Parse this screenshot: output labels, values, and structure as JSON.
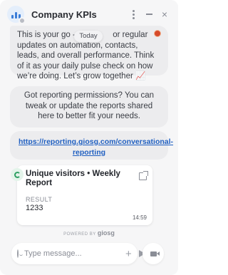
{
  "header": {
    "title": "Company KPIs",
    "icons": [
      "chart-avatar-icon",
      "kebab-menu-icon",
      "minimize-icon",
      "close-icon"
    ],
    "close_glyph": "×"
  },
  "date_pill": "Today",
  "messages": [
    {
      "text": "This is your go - t        or regular updates on automation, contacts, leads, and overall performance. Think of it as your daily pulse check on how we’re doing. Let’s grow together 📈"
    },
    {
      "text": "Got reporting permissions? You can tweak or update the reports shared here to better fit your needs."
    },
    {
      "link": "https://reporting.giosg.com/conversational-reporting"
    }
  ],
  "report_card": {
    "title": "Unique visitors • Weekly Report",
    "result_label": "RESULT",
    "result_value": "1233",
    "time": "14:59"
  },
  "powered_by": {
    "prefix": "POWERED BY",
    "brand": "giosg"
  },
  "composer": {
    "placeholder": "Type message..."
  },
  "colors": {
    "accent": "#3b7dd8",
    "link": "#1f5fc1",
    "success": "#2ea063",
    "background": "#f6f6f7",
    "bubble": "#ececee"
  }
}
